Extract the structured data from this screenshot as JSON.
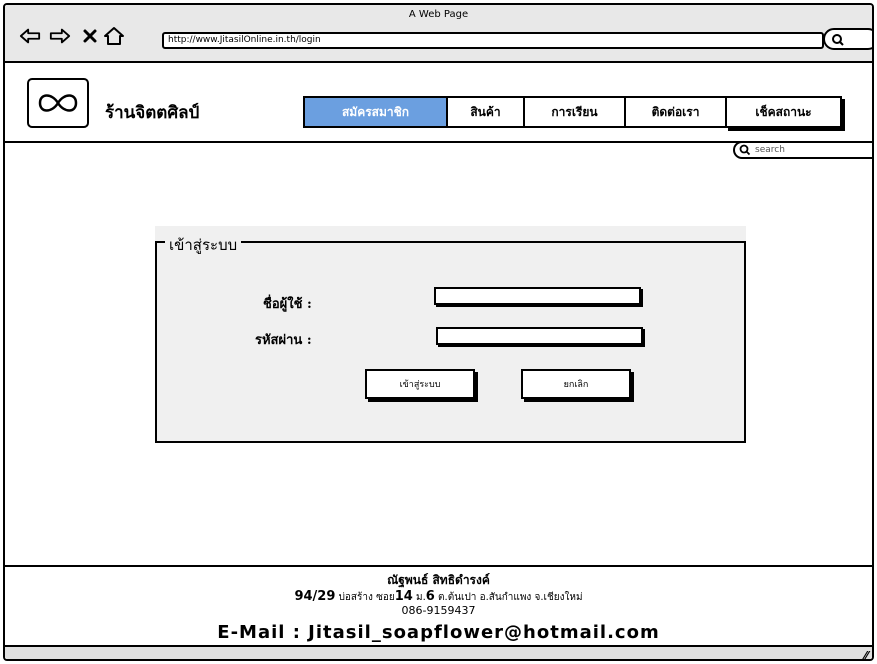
{
  "window": {
    "title": "A Web Page",
    "url": "http://www.JitasilOnline.in.th/login"
  },
  "header": {
    "shop_name": "ร้านจิตตศิลป์",
    "logo_icon": "infinity-icon"
  },
  "nav": {
    "active_color": "#6b9fe0",
    "items": [
      {
        "label": "สมัครสมาชิก",
        "active": true
      },
      {
        "label": "สินค้า",
        "active": false
      },
      {
        "label": "การเรียน",
        "active": false
      },
      {
        "label": "ติดต่อเรา",
        "active": false
      },
      {
        "label": "เช็คสถานะ",
        "active": false
      }
    ]
  },
  "search": {
    "placeholder": "search"
  },
  "login": {
    "legend": "เข้าสู่ระบบ",
    "username_label": "ชื่อผู้ใช้ :",
    "username_value": "",
    "password_label": "รหัสผ่าน :",
    "password_value": "",
    "submit_label": "เข้าสู่ระบบ",
    "cancel_label": "ยกเลิก"
  },
  "footer": {
    "name": "ณัฐพนธ์ สิทธิดำรงค์",
    "address_no": "94/29",
    "address_1": "บ่อสร้าง ซอย",
    "soi_no": "14",
    "moo_label": "ม.",
    "moo_no": "6",
    "address_2": "ต.ต้นเปา อ.สันกำแพง จ.เชียงใหม่",
    "phone": "086-9159437",
    "email": "E-Mail : Jitasil_soapflower@hotmail.com"
  }
}
